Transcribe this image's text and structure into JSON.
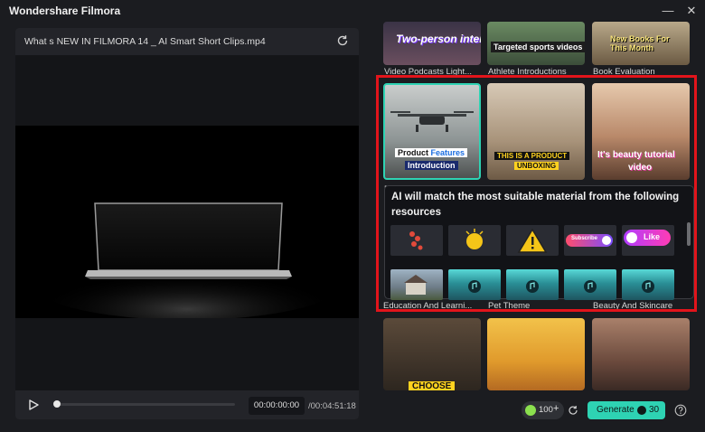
{
  "app": {
    "title": "Wondershare Filmora"
  },
  "player": {
    "file_name": "What s NEW IN FILMORA 14 _ AI Smart Short Clips.mp4",
    "time_current": "00:00:00:00",
    "time_total": "/00:04:51:18"
  },
  "templates": {
    "row1": [
      {
        "label": "Video Podcasts Light...",
        "overlay": "Two-person interaction"
      },
      {
        "label": "Athlete Introductions",
        "overlay": "Targeted sports videos"
      },
      {
        "label": "Book Evaluation",
        "overlay": "New Books For This Month"
      }
    ],
    "row2": [
      {
        "overlay_a": "Product",
        "overlay_b": "Features",
        "overlay_c": "Introduction"
      },
      {
        "overlay_a": "THIS IS A PRODUCT",
        "overlay_b": "UNBOXING"
      },
      {
        "overlay_a": "It's beauty tutorial",
        "overlay_b": "video"
      }
    ],
    "row3_partial_labels": [
      "Education And Learni...",
      "Pet Theme",
      "Beauty And Skincare"
    ],
    "row4": [
      {
        "overlay": "CHOOSE"
      }
    ]
  },
  "tooltip": {
    "text": "AI will match the most suitable material from the following resources",
    "badge_subscribe": "Subscribe",
    "badge_like": "Like",
    "hidden_letter": "P"
  },
  "bottom": {
    "credits": "100",
    "credits_plus": "+",
    "generate_label": "Generate",
    "generate_cost": "30"
  },
  "colors": {
    "highlight": "#e2141b",
    "generate": "#2ed3b3",
    "background": "#1b1c20"
  }
}
